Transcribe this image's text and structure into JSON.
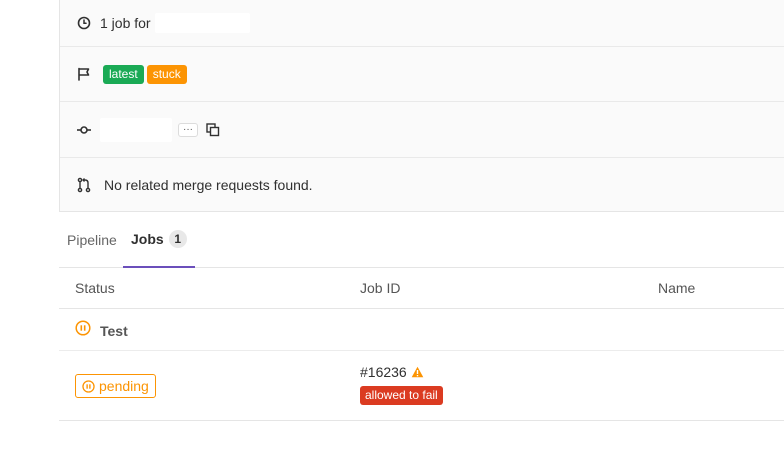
{
  "info": {
    "jobs_summary": "1 job for",
    "badges": {
      "latest": "latest",
      "stuck": "stuck"
    },
    "ellipsis": "···",
    "merge_requests": "No related merge requests found."
  },
  "tabs": {
    "pipeline": "Pipeline",
    "jobs": "Jobs",
    "jobs_count": "1"
  },
  "table": {
    "headers": {
      "status": "Status",
      "job_id": "Job ID",
      "name": "Name"
    },
    "stage": {
      "name": "Test"
    },
    "job": {
      "status": "pending",
      "id": "#16236",
      "allowed_to_fail": "allowed to fail"
    }
  },
  "colors": {
    "latest": "#1aaa55",
    "stuck": "#fc9403",
    "pending": "#fc9403",
    "allowed_to_fail": "#db3b21",
    "active_tab": "#6b4fbb"
  },
  "icons": {
    "jobs_row": "clock-icon",
    "badges_row": "flag-icon",
    "commit_row": "commit-icon",
    "mr_row": "merge-request-icon",
    "copy": "copy-icon",
    "stage_status": "pause-icon",
    "job_warning": "warning-icon"
  }
}
